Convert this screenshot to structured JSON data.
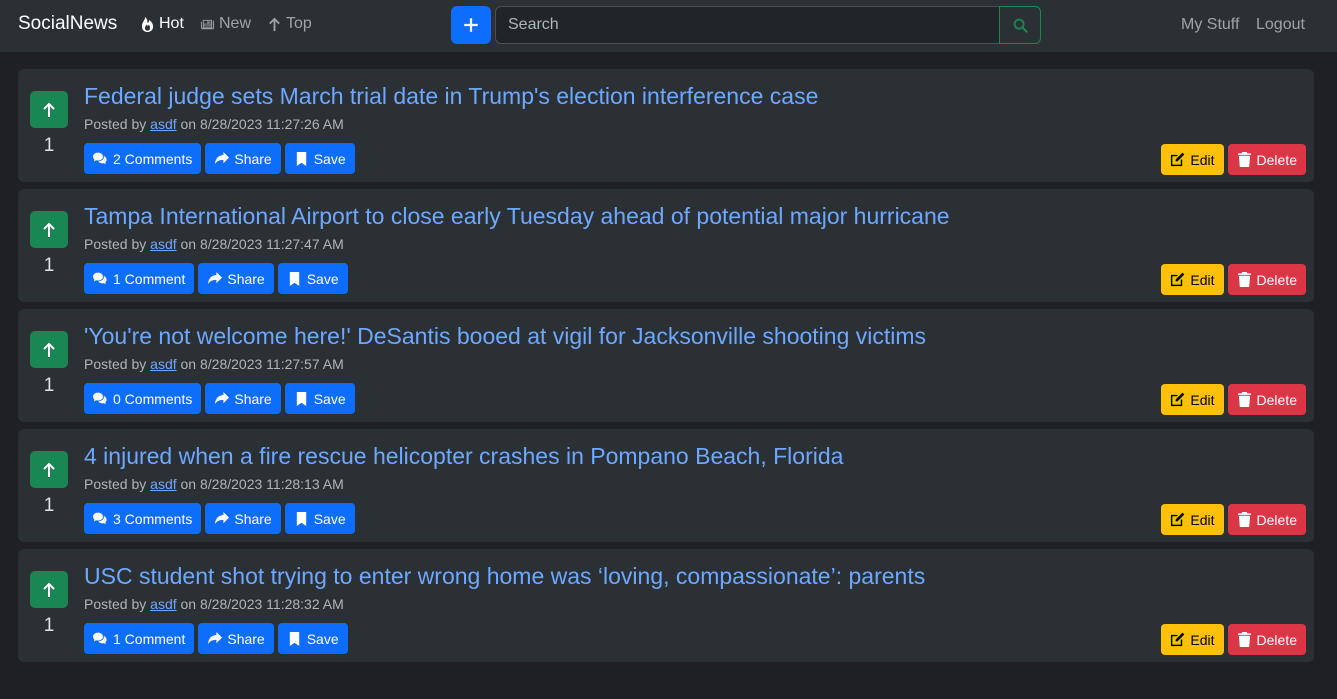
{
  "nav": {
    "brand": "SocialNews",
    "hot": "Hot",
    "new": "New",
    "top": "Top",
    "search_placeholder": "Search",
    "my_stuff": "My Stuff",
    "logout": "Logout"
  },
  "labels": {
    "share": "Share",
    "save": "Save",
    "edit": "Edit",
    "delete": "Delete",
    "posted_by": "Posted by",
    "on": "on"
  },
  "posts": [
    {
      "title": "Federal judge sets March trial date in Trump's election interference case",
      "user": "asdf",
      "date": "8/28/2023 11:27:26 AM",
      "votes": "1",
      "comments": "2 Comments"
    },
    {
      "title": "Tampa International Airport to close early Tuesday ahead of potential major hurricane",
      "user": "asdf",
      "date": "8/28/2023 11:27:47 AM",
      "votes": "1",
      "comments": "1 Comment"
    },
    {
      "title": "'You're not welcome here!' DeSantis booed at vigil for Jacksonville shooting victims",
      "user": "asdf",
      "date": "8/28/2023 11:27:57 AM",
      "votes": "1",
      "comments": "0 Comments"
    },
    {
      "title": "4 injured when a fire rescue helicopter crashes in Pompano Beach, Florida",
      "user": "asdf",
      "date": "8/28/2023 11:28:13 AM",
      "votes": "1",
      "comments": "3 Comments"
    },
    {
      "title": "USC student shot trying to enter wrong home was ‘loving, compassionate’: parents",
      "user": "asdf",
      "date": "8/28/2023 11:28:32 AM",
      "votes": "1",
      "comments": "1 Comment"
    }
  ],
  "colors": {
    "primary": "#0d6efd",
    "success": "#198754",
    "warning": "#ffc107",
    "danger": "#dc3545",
    "link": "#6ea8fe"
  }
}
